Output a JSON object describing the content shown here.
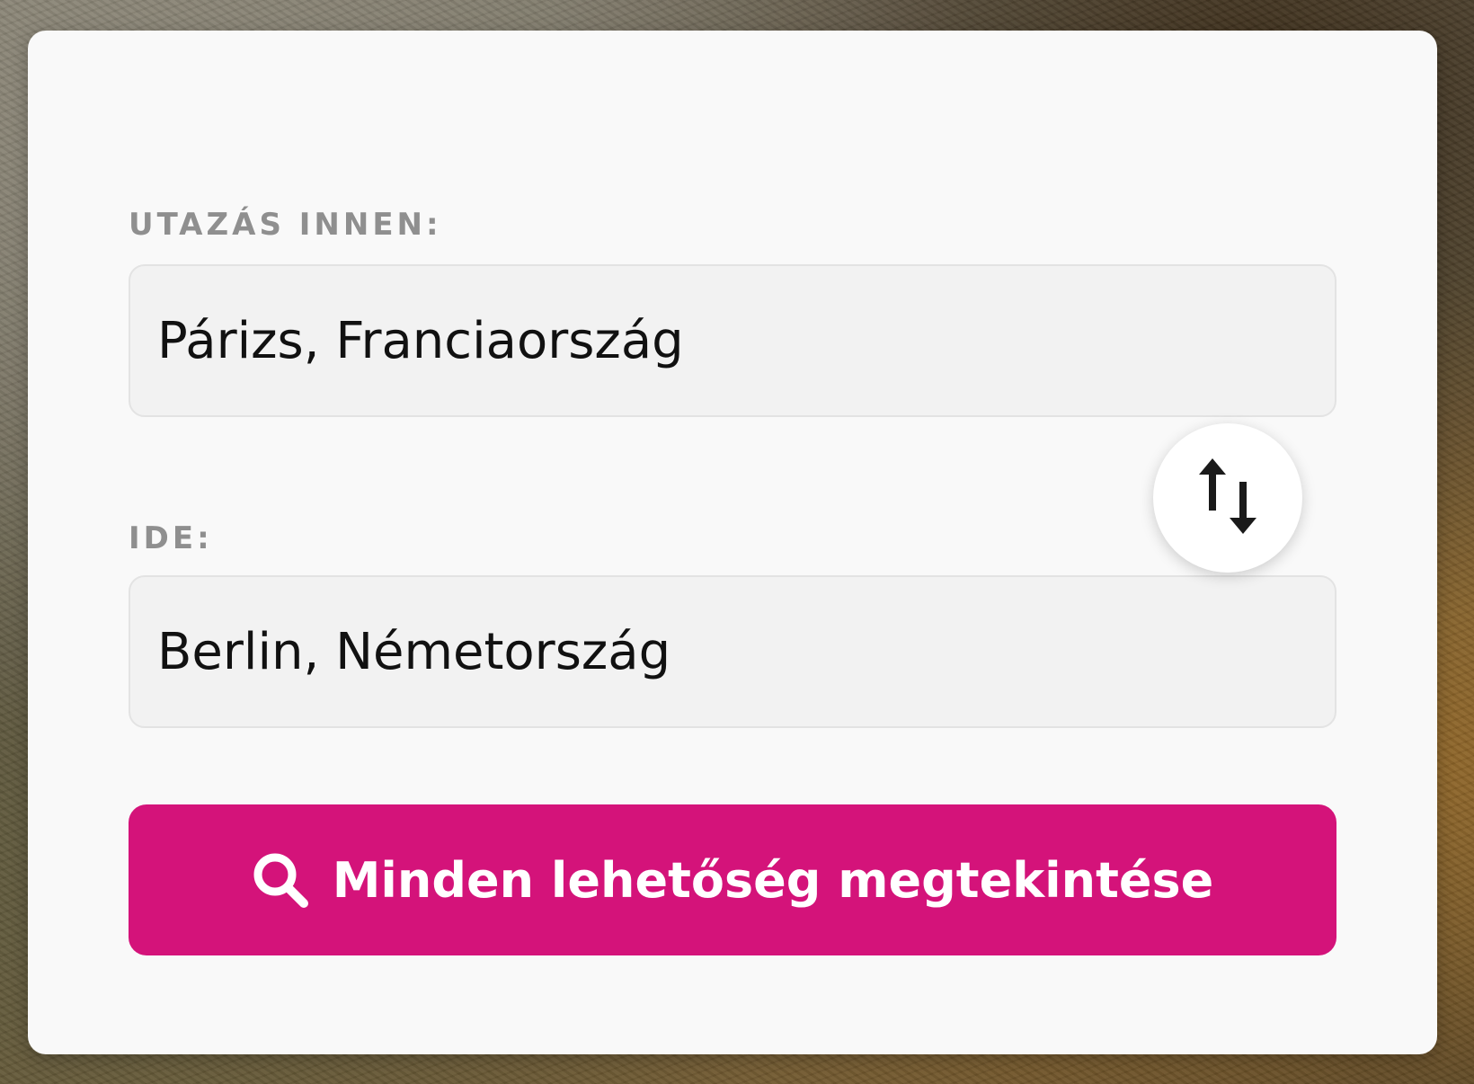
{
  "trip_form": {
    "from_label": "UTAZÁS INNEN:",
    "from_value": "Párizs, Franciaország",
    "to_label": "IDE:",
    "to_value": "Berlin, Németország",
    "swap_icon": "swap-vertical-arrows-icon",
    "search_icon": "search-icon",
    "search_button_label": "Minden lehetőség megtekintése"
  },
  "colors": {
    "accent": "#d4137a",
    "card_background": "#f9f9f9",
    "field_background": "#f2f2f2",
    "label_text": "#8f8f8f",
    "value_text": "#111111"
  }
}
